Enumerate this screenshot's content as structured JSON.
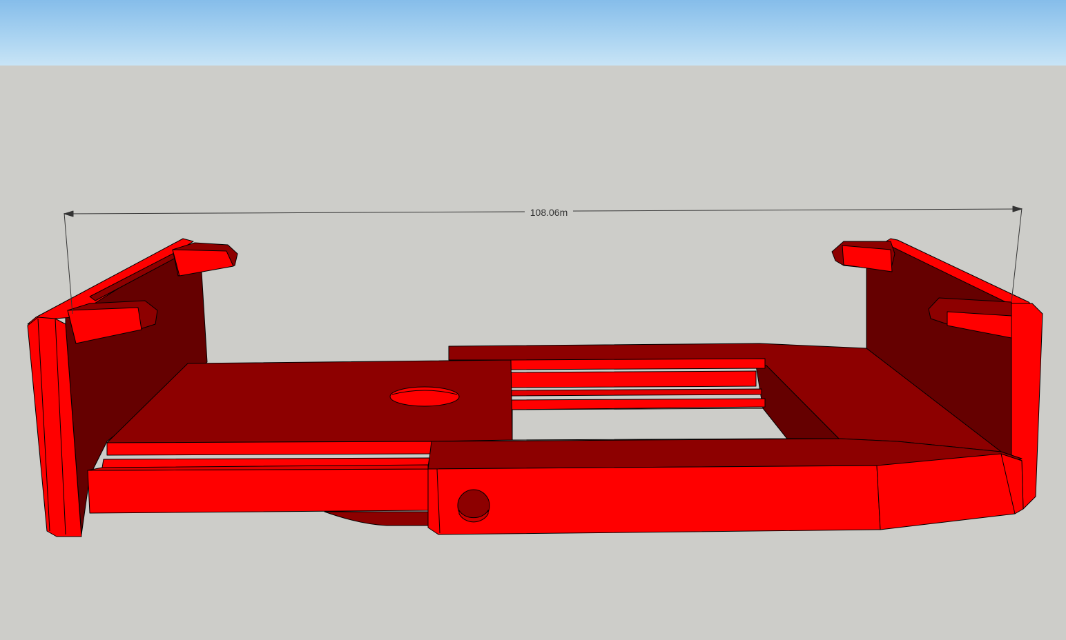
{
  "dimension": {
    "label": "108.06m"
  },
  "colors": {
    "sky_top": "#86bdea",
    "sky_bottom": "#c8e4f6",
    "ground": "#cdcdc9",
    "face_bright": "#ff0000",
    "face_mid": "#e30000",
    "face_dark": "#8d0000",
    "face_darkest": "#650000",
    "edge": "#000000"
  },
  "model": {
    "name_icon": "red-phone-holder-model"
  }
}
